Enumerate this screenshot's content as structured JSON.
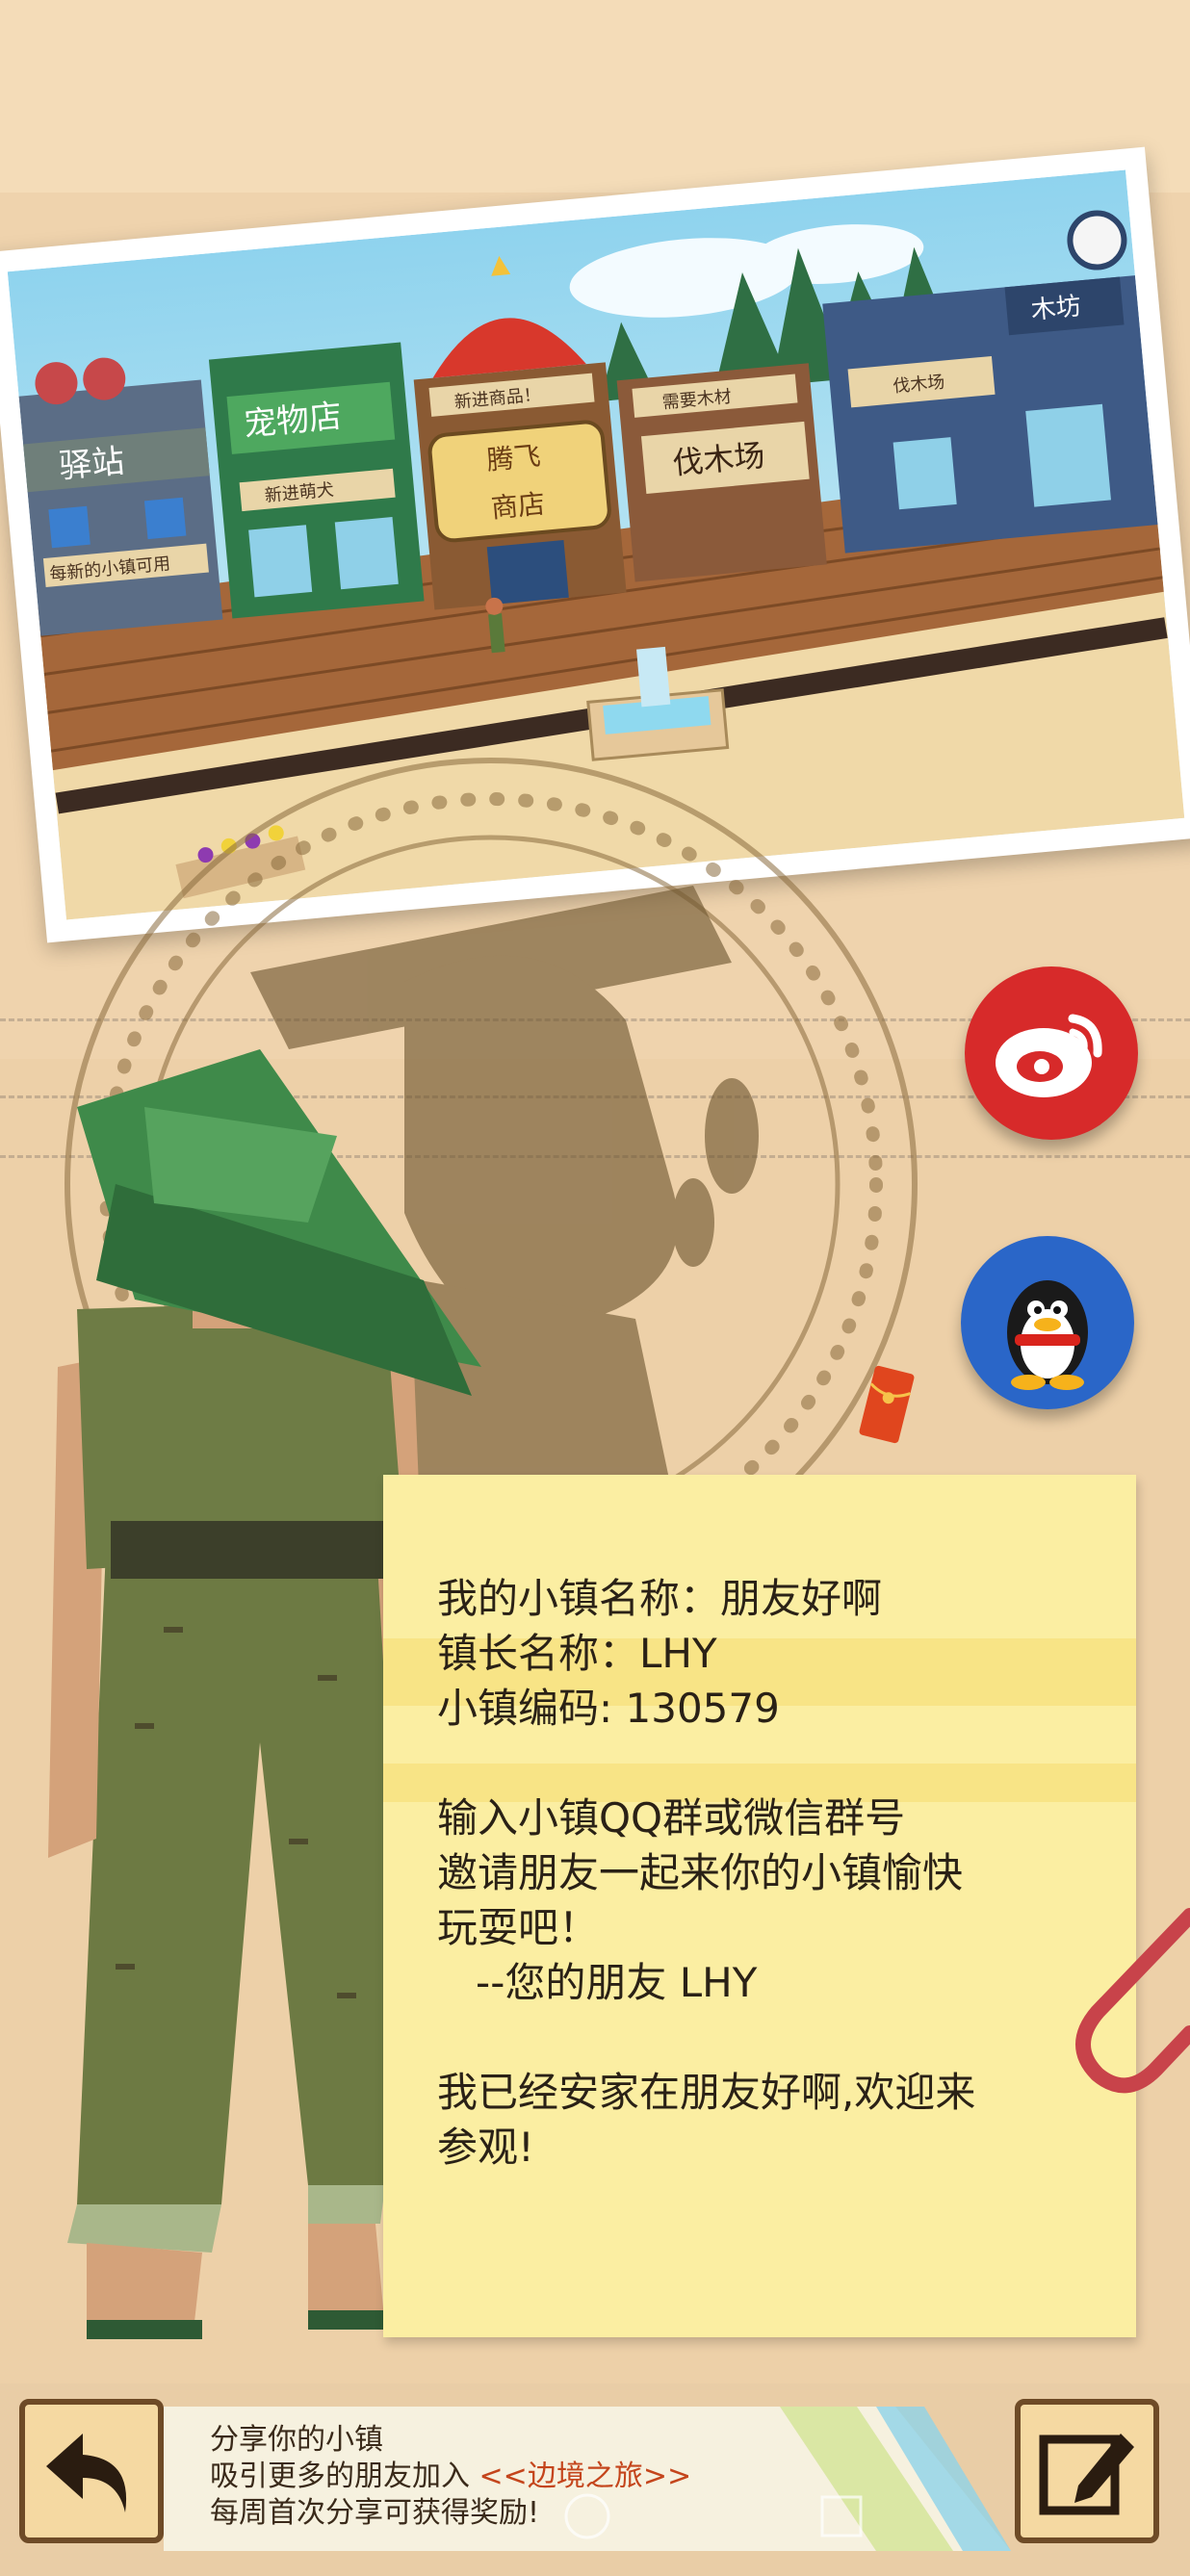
{
  "photo": {
    "signs": {
      "station": "驿站",
      "pet_shop": "宠物店",
      "new_goods": "新进商品！",
      "shop_brand_top": "腾飞",
      "shop_brand_bottom": "商店",
      "lumber_yard": "伐木场",
      "need_wood": "需要木材",
      "woodcut": "伐木场",
      "pet_new": "新进萌犬",
      "town_tip": "每新的小镇可用",
      "right_top": "木坊"
    }
  },
  "note": {
    "town_name_line": "我的小镇名称：朋友好啊",
    "mayor_line": "镇长名称：LHY",
    "code_line": "小镇编码: 130579",
    "invite_line1": "输入小镇QQ群或微信群号",
    "invite_line2": "邀请朋友一起来你的小镇愉快",
    "invite_line3": "玩耍吧！",
    "signature": "   --您的朋友 LHY",
    "welcome_line1": "我已经安家在朋友好啊,欢迎来",
    "welcome_line2": "参观!"
  },
  "share": {
    "title": "分享你的小镇",
    "line2_prefix": "吸引更多的朋友加入 ",
    "game_name": "<<边境之旅>>",
    "line3": "每周首次分享可获得奖励!"
  },
  "icons": {
    "weibo": "weibo-icon",
    "qq": "qq-penguin-icon",
    "back": "back-arrow-icon",
    "edit": "edit-pencil-icon",
    "red_packet": "red-packet-icon"
  },
  "colors": {
    "accent": "#c4451c",
    "weibo_red": "#d72a2a",
    "qq_blue": "#2a66c8",
    "note_yellow": "#fbeea2"
  }
}
